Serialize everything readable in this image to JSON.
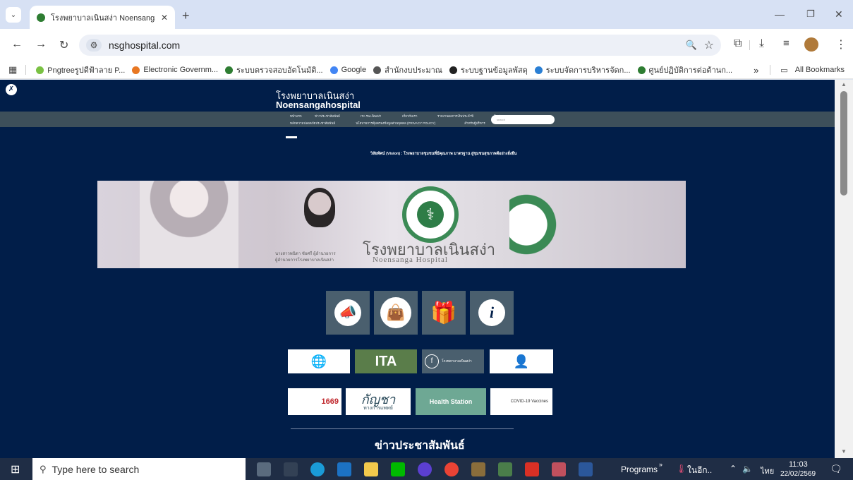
{
  "browser": {
    "tab_title": "โรงพยาบาลเนินสง่า Noensangaho",
    "url": "nsghospital.com"
  },
  "bookmarks": {
    "items": [
      {
        "label": "Pngtreeรูปดีฟ้าลาย P...",
        "color": "#7ac143"
      },
      {
        "label": "Electronic Governm...",
        "color": "#e87722"
      },
      {
        "label": "ระบบตรวจสอบอัตโนมัติ...",
        "color": "#2e7d32"
      },
      {
        "label": "Google",
        "color": "#4285f4"
      },
      {
        "label": "สำนักงบประมาณ",
        "color": "#555555"
      },
      {
        "label": "ระบบฐานข้อมูลพัสดุ",
        "color": "#222222"
      },
      {
        "label": "ระบบจัดการบริหารจัดก...",
        "color": "#2a7fd4"
      },
      {
        "label": "ศูนย์ปฏิบัติการต่อต้านก...",
        "color": "#2e7d32"
      }
    ],
    "all_label": "All Bookmarks",
    "overflow": "»"
  },
  "site": {
    "name_th": "โรงพยาบาลเนินสง่า",
    "name_en": "Noensangahospital",
    "nav_row1": [
      "หน้าแรก",
      "ข่าวประชาสัมพันธ์",
      "ITA รพ.เนินสง่า",
      "เกี่ยวกับเรา",
      "รายงานผลการเงินประจำปี",
      "ติดต่อเรา"
    ],
    "nav_row2": [
      "หลักความปลอดภัยประชาสัมพันธ์",
      "นโยบายการคุ้มครองข้อมูลส่วนบุคคล (PRIVACY POLICY)",
      "สำหรับผู้บริหาร"
    ],
    "search_placeholder": "search",
    "vision": "วิสัยทัศน์ (Vision) : โรงพยาบาลชุมชนที่มีคุณภาพ มาตรฐาน สู่ชุมชนสุขภาพดีอย่างยั่งยืน",
    "banner_title_th": "โรงพยาบาลเนินสง่า",
    "banner_title_en": "Noensanga Hospital",
    "banner_caption1": "นางสาวพนิดา ชัยศรี ผู้อำนวยการ",
    "banner_caption2": "ผู้อำนวยการโรงพยาบาลเนินสง่า",
    "badges_row1": [
      "",
      "ITA",
      "โรงพยาบาลเนินสง่า",
      ""
    ],
    "badges_row2": [
      "1669",
      "กัญชา",
      "Health Station",
      "COVID-19 Vaccines"
    ],
    "badge_sub1": "ทางการแพทย์",
    "news_heading": "ข่าวประชาสัมพันธ์"
  },
  "taskbar": {
    "search_placeholder": "Type here to search",
    "programs_label": "Programs",
    "weather_label": "ในอีก..",
    "lang": "ไทย",
    "time": "11:03",
    "date": "22/02/2569"
  }
}
